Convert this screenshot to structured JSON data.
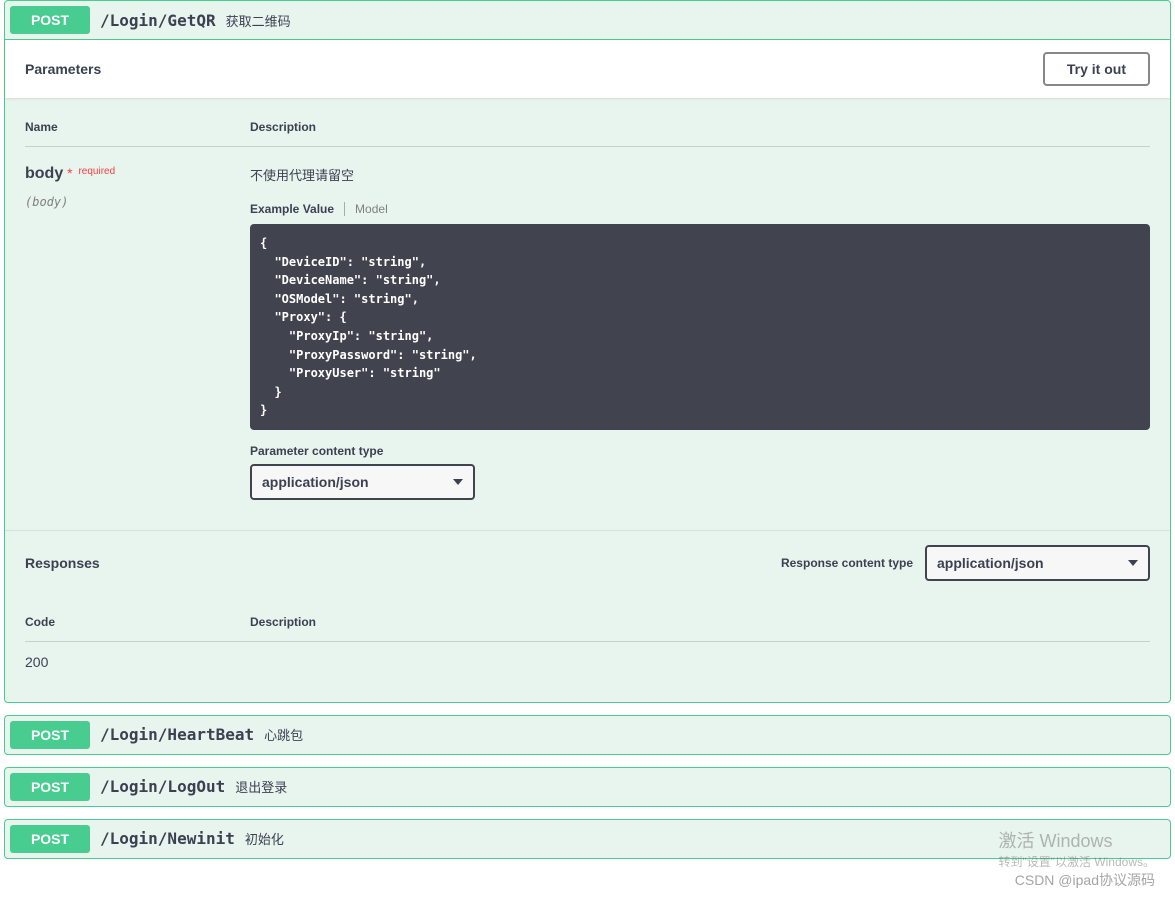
{
  "expanded_endpoint": {
    "method": "POST",
    "path": "/Login/GetQR",
    "summary": "获取二维码",
    "parameters_heading": "Parameters",
    "try_it_out": "Try it out",
    "table": {
      "name_header": "Name",
      "desc_header": "Description"
    },
    "param": {
      "name": "body",
      "required_label": "required",
      "in": "(body)",
      "description": "不使用代理请留空",
      "example_tab": "Example Value",
      "model_tab": "Model",
      "example_json": "{\n  \"DeviceID\": \"string\",\n  \"DeviceName\": \"string\",\n  \"OSModel\": \"string\",\n  \"Proxy\": {\n    \"ProxyIp\": \"string\",\n    \"ProxyPassword\": \"string\",\n    \"ProxyUser\": \"string\"\n  }\n}",
      "content_type_label": "Parameter content type",
      "content_type_value": "application/json"
    },
    "responses": {
      "heading": "Responses",
      "content_type_label": "Response content type",
      "content_type_value": "application/json",
      "code_header": "Code",
      "desc_header": "Description",
      "rows": [
        {
          "code": "200",
          "description": ""
        }
      ]
    }
  },
  "collapsed_endpoints": [
    {
      "method": "POST",
      "path": "/Login/HeartBeat",
      "summary": "心跳包"
    },
    {
      "method": "POST",
      "path": "/Login/LogOut",
      "summary": "退出登录"
    },
    {
      "method": "POST",
      "path": "/Login/Newinit",
      "summary": "初始化"
    }
  ],
  "watermark": {
    "title": "激活 Windows",
    "sub": "转到\"设置\"以激活 Windows。"
  },
  "csdn": "CSDN @ipad协议源码"
}
